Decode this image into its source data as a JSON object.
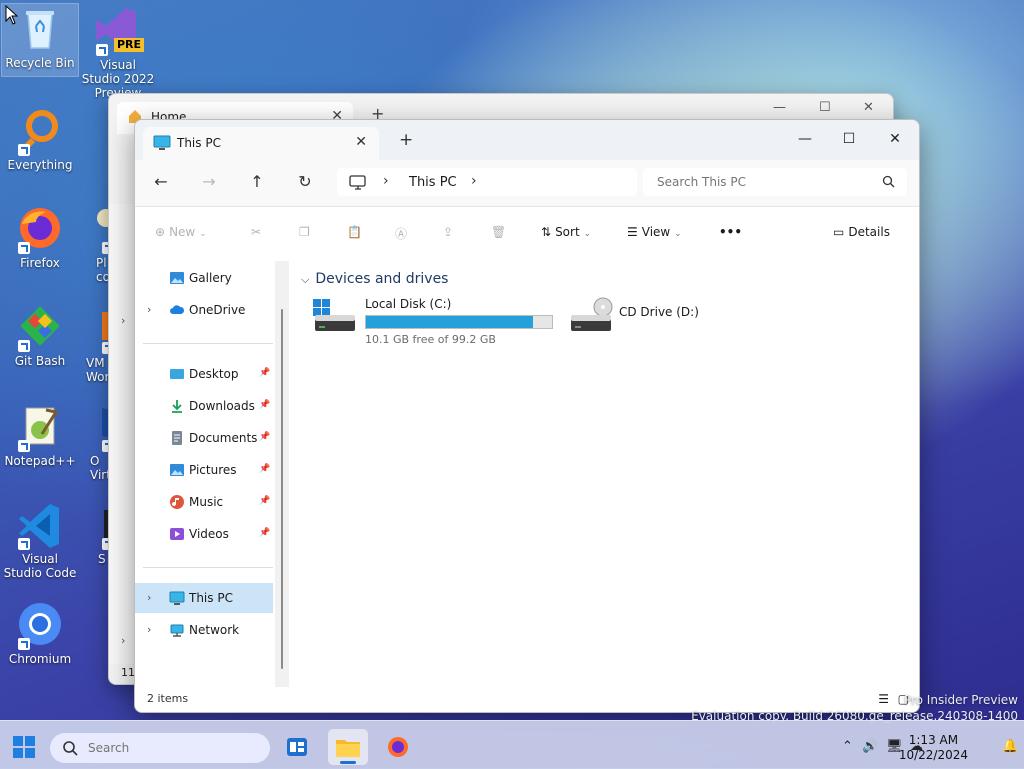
{
  "desktop": {
    "icons_col1": [
      {
        "label": "Recycle Bin"
      },
      {
        "label": "Everything"
      },
      {
        "label": "Firefox"
      },
      {
        "label": "Git Bash"
      },
      {
        "label": "Notepad++"
      },
      {
        "label": "Visual Studio Code"
      },
      {
        "label": "Chromium"
      }
    ],
    "icons_col2": [
      {
        "label": "Visual Studio 2022 Preview",
        "badge": "PRE"
      },
      {
        "label": "Pl co"
      },
      {
        "label": "VM Wor"
      },
      {
        "label": "O Virt"
      },
      {
        "label": "S"
      }
    ]
  },
  "back_window": {
    "tab_label": "Home",
    "status_partial": "11"
  },
  "explorer": {
    "tab_label": "This PC",
    "new_tab": "+",
    "window_controls": {
      "minimize": "—",
      "maximize": "☐",
      "close": "✕"
    },
    "address": {
      "crumb": "This PC"
    },
    "search": {
      "placeholder": "Search This PC"
    },
    "toolbar": {
      "new_label": "New",
      "sort_label": "Sort",
      "view_label": "View",
      "more_label": "•••",
      "details_label": "Details"
    },
    "sidebar": {
      "gallery": "Gallery",
      "onedrive": "OneDrive",
      "quick": [
        {
          "label": "Desktop"
        },
        {
          "label": "Downloads"
        },
        {
          "label": "Documents"
        },
        {
          "label": "Pictures"
        },
        {
          "label": "Music"
        },
        {
          "label": "Videos"
        }
      ],
      "this_pc": "This PC",
      "network": "Network"
    },
    "content": {
      "group_title": "Devices and drives",
      "drives": [
        {
          "name": "Local Disk (C:)",
          "free_text": "10.1 GB free of 99.2 GB",
          "used_fraction": 0.898
        },
        {
          "name": "CD Drive (D:)"
        }
      ]
    },
    "status": {
      "item_count": "2 items"
    }
  },
  "watermark": {
    "line1": "Pro Insider Preview",
    "line2": "Evaluation copy. Build 26080.ge_release.240308-1400"
  },
  "taskbar": {
    "search_placeholder": "Search",
    "time": "1:13 AM",
    "date": "10/22/2024"
  },
  "colors": {
    "accent": "#26a0da",
    "selection": "#cce4f7"
  }
}
